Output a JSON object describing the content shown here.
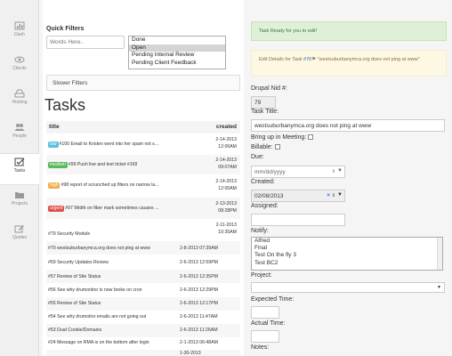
{
  "sidebar": {
    "items": [
      {
        "label": "Dash",
        "icon": "dashboard-icon"
      },
      {
        "label": "Clients",
        "icon": "eye-icon"
      },
      {
        "label": "Hosting",
        "icon": "hdd-icon"
      },
      {
        "label": "People",
        "icon": "people-icon"
      },
      {
        "label": "Tasks",
        "icon": "tasks-icon",
        "active": true
      },
      {
        "label": "Projects",
        "icon": "folder-icon"
      },
      {
        "label": "Quotes",
        "icon": "edit-icon"
      }
    ]
  },
  "filters": {
    "title": "Quick Filters",
    "search_placeholder": "Words Here..",
    "status_options": [
      "Done",
      "Open",
      "Pending Internal Review",
      "Pending Client Feedback"
    ],
    "selected_status": "Open",
    "slower_label": "Slower Filters"
  },
  "tasks": {
    "heading": "Tasks",
    "col_title": "title",
    "col_created": "created",
    "rows": [
      {
        "badge": "low",
        "badge_color": "#5bc0de",
        "title": "#100 Email to Kristen went into her spam not s...",
        "date": "2-14-2013",
        "time": "12:00AM"
      },
      {
        "badge": "medium",
        "badge_color": "#5cb85c",
        "title": "#99 Push live and test ticket #169",
        "date": "2-14-2013",
        "time": "09:07AM"
      },
      {
        "badge": "high",
        "badge_color": "#f0ad4e",
        "title": "#98 report of scrunched up filters on narrow la...",
        "date": "2-14-2013",
        "time": "12:00AM"
      },
      {
        "badge": "urgent",
        "badge_color": "#d9534f",
        "title": "#97 Width on fiber mark sometimes causes ...",
        "date": "2-13-2013",
        "time": "08:28PM"
      },
      {
        "badge": "",
        "title": "#79 Security Module",
        "date": "2-11-2013",
        "time": "10:35AM"
      }
    ],
    "flat_rows": [
      {
        "title": "#70 westsuburbanymca.org does not ping at www",
        "date": "2-8-2013 07:39AM"
      },
      {
        "title": "#59 Security Updates Review",
        "date": "2-6-2013 12:59PM"
      },
      {
        "title": "#57 Review of Site Status",
        "date": "2-6-2013 12:35PM"
      },
      {
        "title": "#56 See why drumonitor is now broke on cron",
        "date": "2-6-2013 12:29PM"
      },
      {
        "title": "#55 Review of Site Status",
        "date": "2-6-2013 12:17PM"
      },
      {
        "title": "#54 See why drumoitor emails are not going out",
        "date": "2-6-2013 11:47AM"
      },
      {
        "title": "#53 Dual Cookie/Domains",
        "date": "2-6-2013 11:26AM"
      },
      {
        "title": "#24 Message on RMA is on the bottom after login",
        "date": "2-1-2013 06:48AM"
      },
      {
        "title": "",
        "date": "1-30-2013"
      }
    ]
  },
  "form": {
    "alert_ok": "Task Ready for you to edit!",
    "alert_info_prefix": "Edit Details for Task ",
    "alert_info_link": "#70",
    "alert_info_text": " \"westsuburbanymca.org does not ping at www\"",
    "nid_label": "Drupal Nid #:",
    "nid_value": "79",
    "title_label": "Task Title:",
    "title_value": "westsuburbanymca.org does not ping at www",
    "meeting_label": "Bring up in Meeting:",
    "billable_label": "Billable:",
    "due_label": "Due:",
    "due_placeholder": "mm/dd/yyyy",
    "created_label": "Created:",
    "created_value": "02/08/2013",
    "assigned_label": "Assigned:",
    "notify_label": "Notify:",
    "notify_options": [
      "Alfred",
      "Final",
      "Test On the fly 3",
      "Test BC2"
    ],
    "project_label": "Project:",
    "expected_label": "Expected Time:",
    "actual_label": "Actual Time:",
    "notes_label": "Notes:"
  }
}
